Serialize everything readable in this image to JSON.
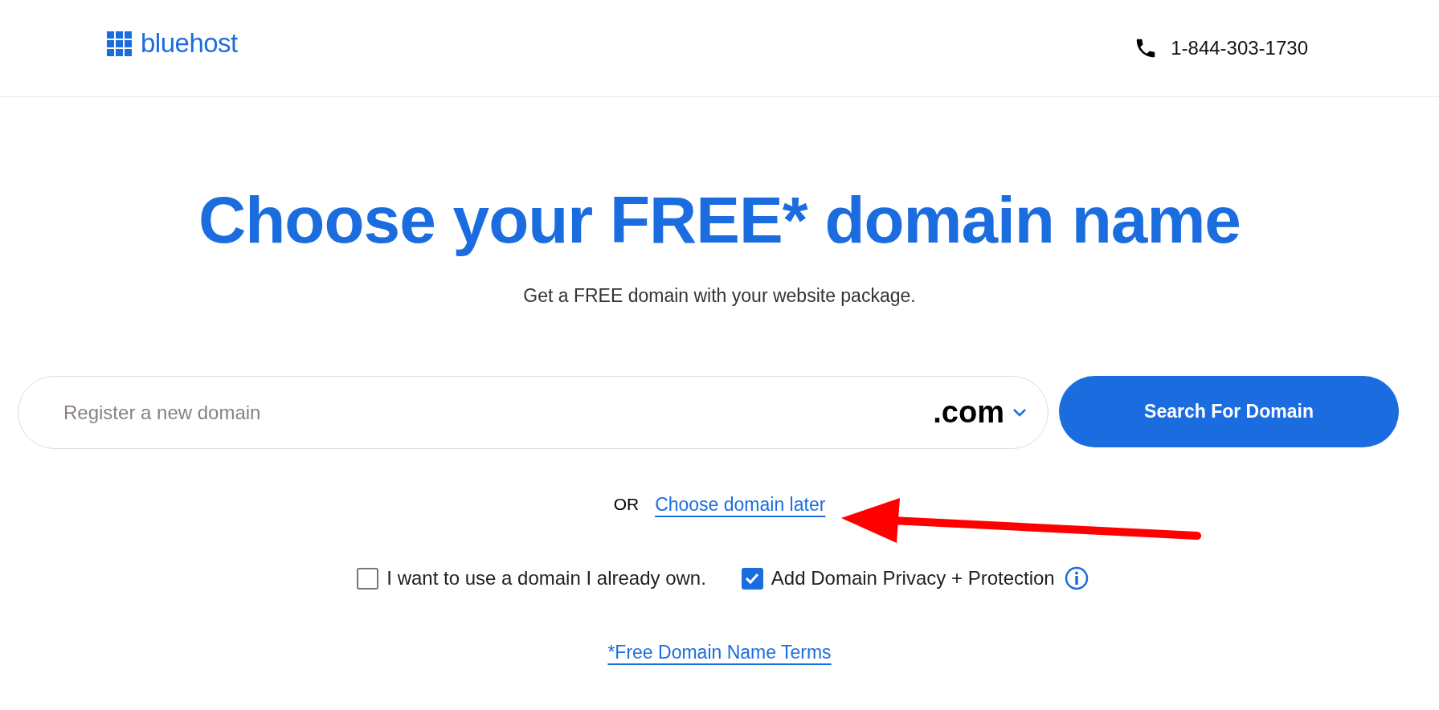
{
  "header": {
    "logo": "bluehost",
    "phone": "1-844-303-1730"
  },
  "heading": "Choose your FREE* domain name",
  "subtitle": "Get a FREE domain with your website package.",
  "search": {
    "placeholder": "Register a new domain",
    "tld": ".com",
    "button": "Search For Domain"
  },
  "alternative": {
    "prefix": "OR",
    "link": "Choose domain later"
  },
  "options": [
    {
      "label": "I want to use a domain I already own.",
      "checked": false,
      "info": false
    },
    {
      "label": "Add Domain Privacy + Protection",
      "checked": true,
      "info": true
    }
  ],
  "terms_link": "*Free Domain Name Terms"
}
